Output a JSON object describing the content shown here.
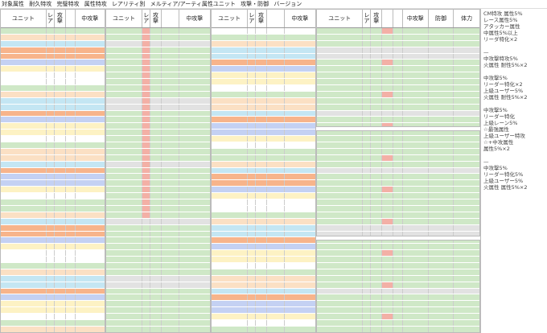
{
  "top_bar": {
    "items": [
      "対象属性",
      "耐久特攻",
      "完璧特攻",
      "属性特攻",
      "レアリティ別",
      "メルティア/アーティ属性ユニット",
      "攻撃・防御",
      "バージョン"
    ]
  },
  "tables": [
    {
      "header": {
        "unit": "ユニット",
        "rarity": "レア",
        "atk": "攻撃",
        "bonus": "中攻撃"
      }
    },
    {
      "header": {
        "unit": "ユニット",
        "rarity": "レア",
        "atk": "攻撃",
        "bonus": "中攻撃"
      }
    },
    {
      "header": {
        "unit": "ユニット",
        "rarity": "レア",
        "atk": "攻撃",
        "bonus": "中攻撃"
      }
    },
    {
      "header": {
        "unit": "ユニット",
        "rarity": "レア",
        "atk": "攻撃",
        "bonus": "中攻撃",
        "col5": "防御",
        "col6": "体力"
      }
    }
  ],
  "notes": {
    "block1": [
      "CM特攻 属性5%",
      "レース属性5%",
      "アタッカー属性",
      "中属性5%以上",
      "リーダ特化×2"
    ],
    "block2": [
      "中攻撃特攻5%",
      "火属性 耐性5%×2"
    ],
    "block3": [
      "中攻撃5%",
      "リーダー特化×2",
      "上級ユーザー5%",
      "火属性 耐性5%×2"
    ],
    "block4": [
      "中攻撃5%",
      "リーダー特化",
      "上級レーン5%",
      "☆最強属性",
      "上級ユーザー特攻",
      "☆+中攻属性",
      "属性5%×2"
    ],
    "block5": [
      "中攻撃5%",
      "リーダー特化5%",
      "上級ユーザー5%",
      "火属性 属性5%×2"
    ]
  }
}
